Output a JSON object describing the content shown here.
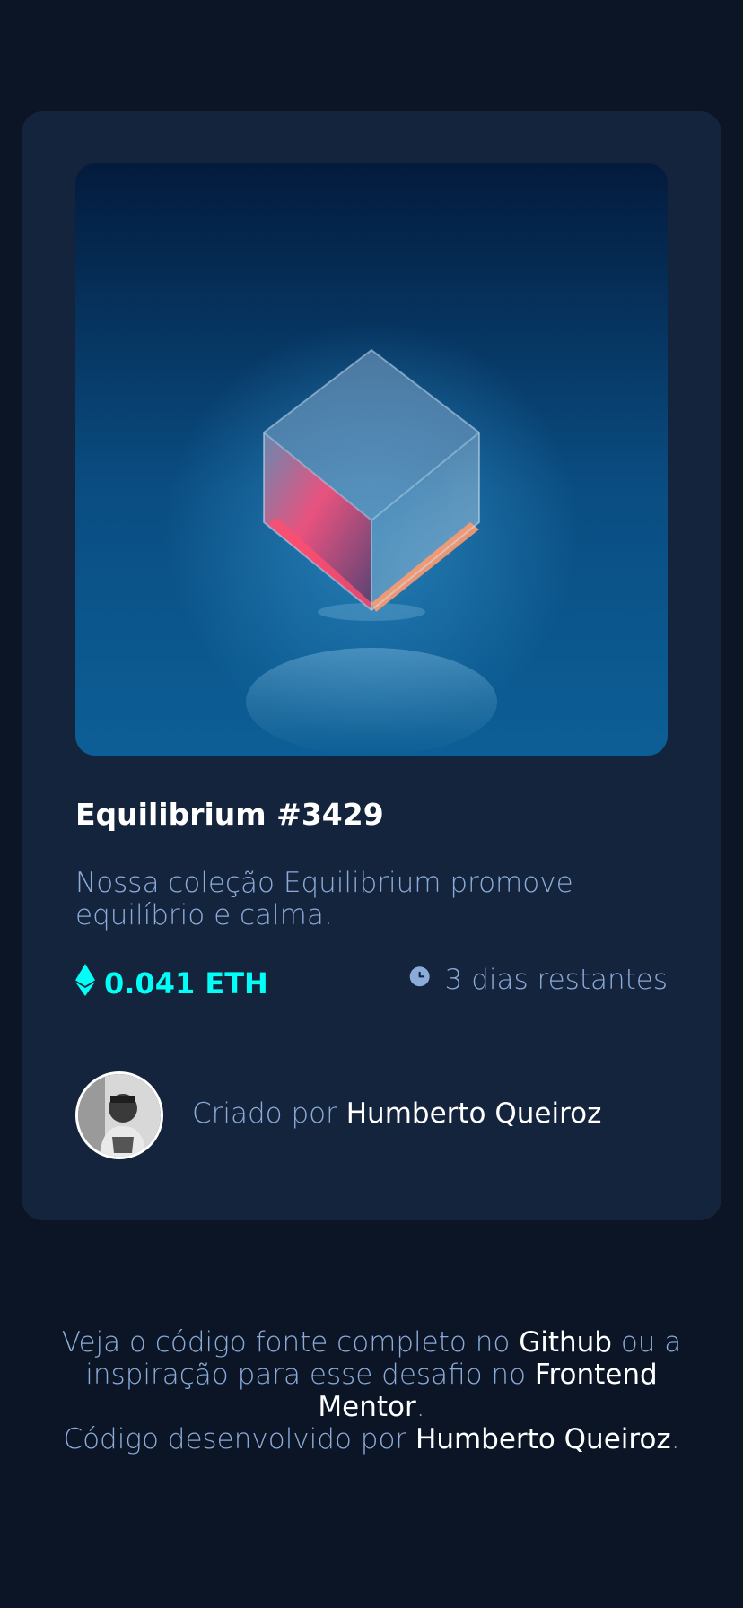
{
  "card": {
    "title": "Equilibrium #3429",
    "description": "Nossa coleção Equilibrium promove equilíbrio e calma.",
    "price": "0.041 ETH",
    "time_left": "3 dias restantes",
    "creator_prefix": "Criado por",
    "creator_name": "Humberto Queiroz",
    "icons": {
      "price": "ethereum-icon",
      "time": "clock-icon"
    }
  },
  "attribution": {
    "text1": "Veja o código fonte completo no",
    "github": "Github",
    "text2": "ou a inspiração para esse desafio no",
    "frontend_mentor": "Frontend Mentor",
    "period1": ".",
    "text3": "Código desenvolvido por",
    "author": "Humberto Queiroz",
    "period2": "."
  },
  "colors": {
    "page_bg": "#0c1526",
    "card_bg": "#15243d",
    "cyan": "#00fff7",
    "soft_blue": "#8bacd9",
    "white": "#ffffff",
    "divider": "#2e405a"
  }
}
